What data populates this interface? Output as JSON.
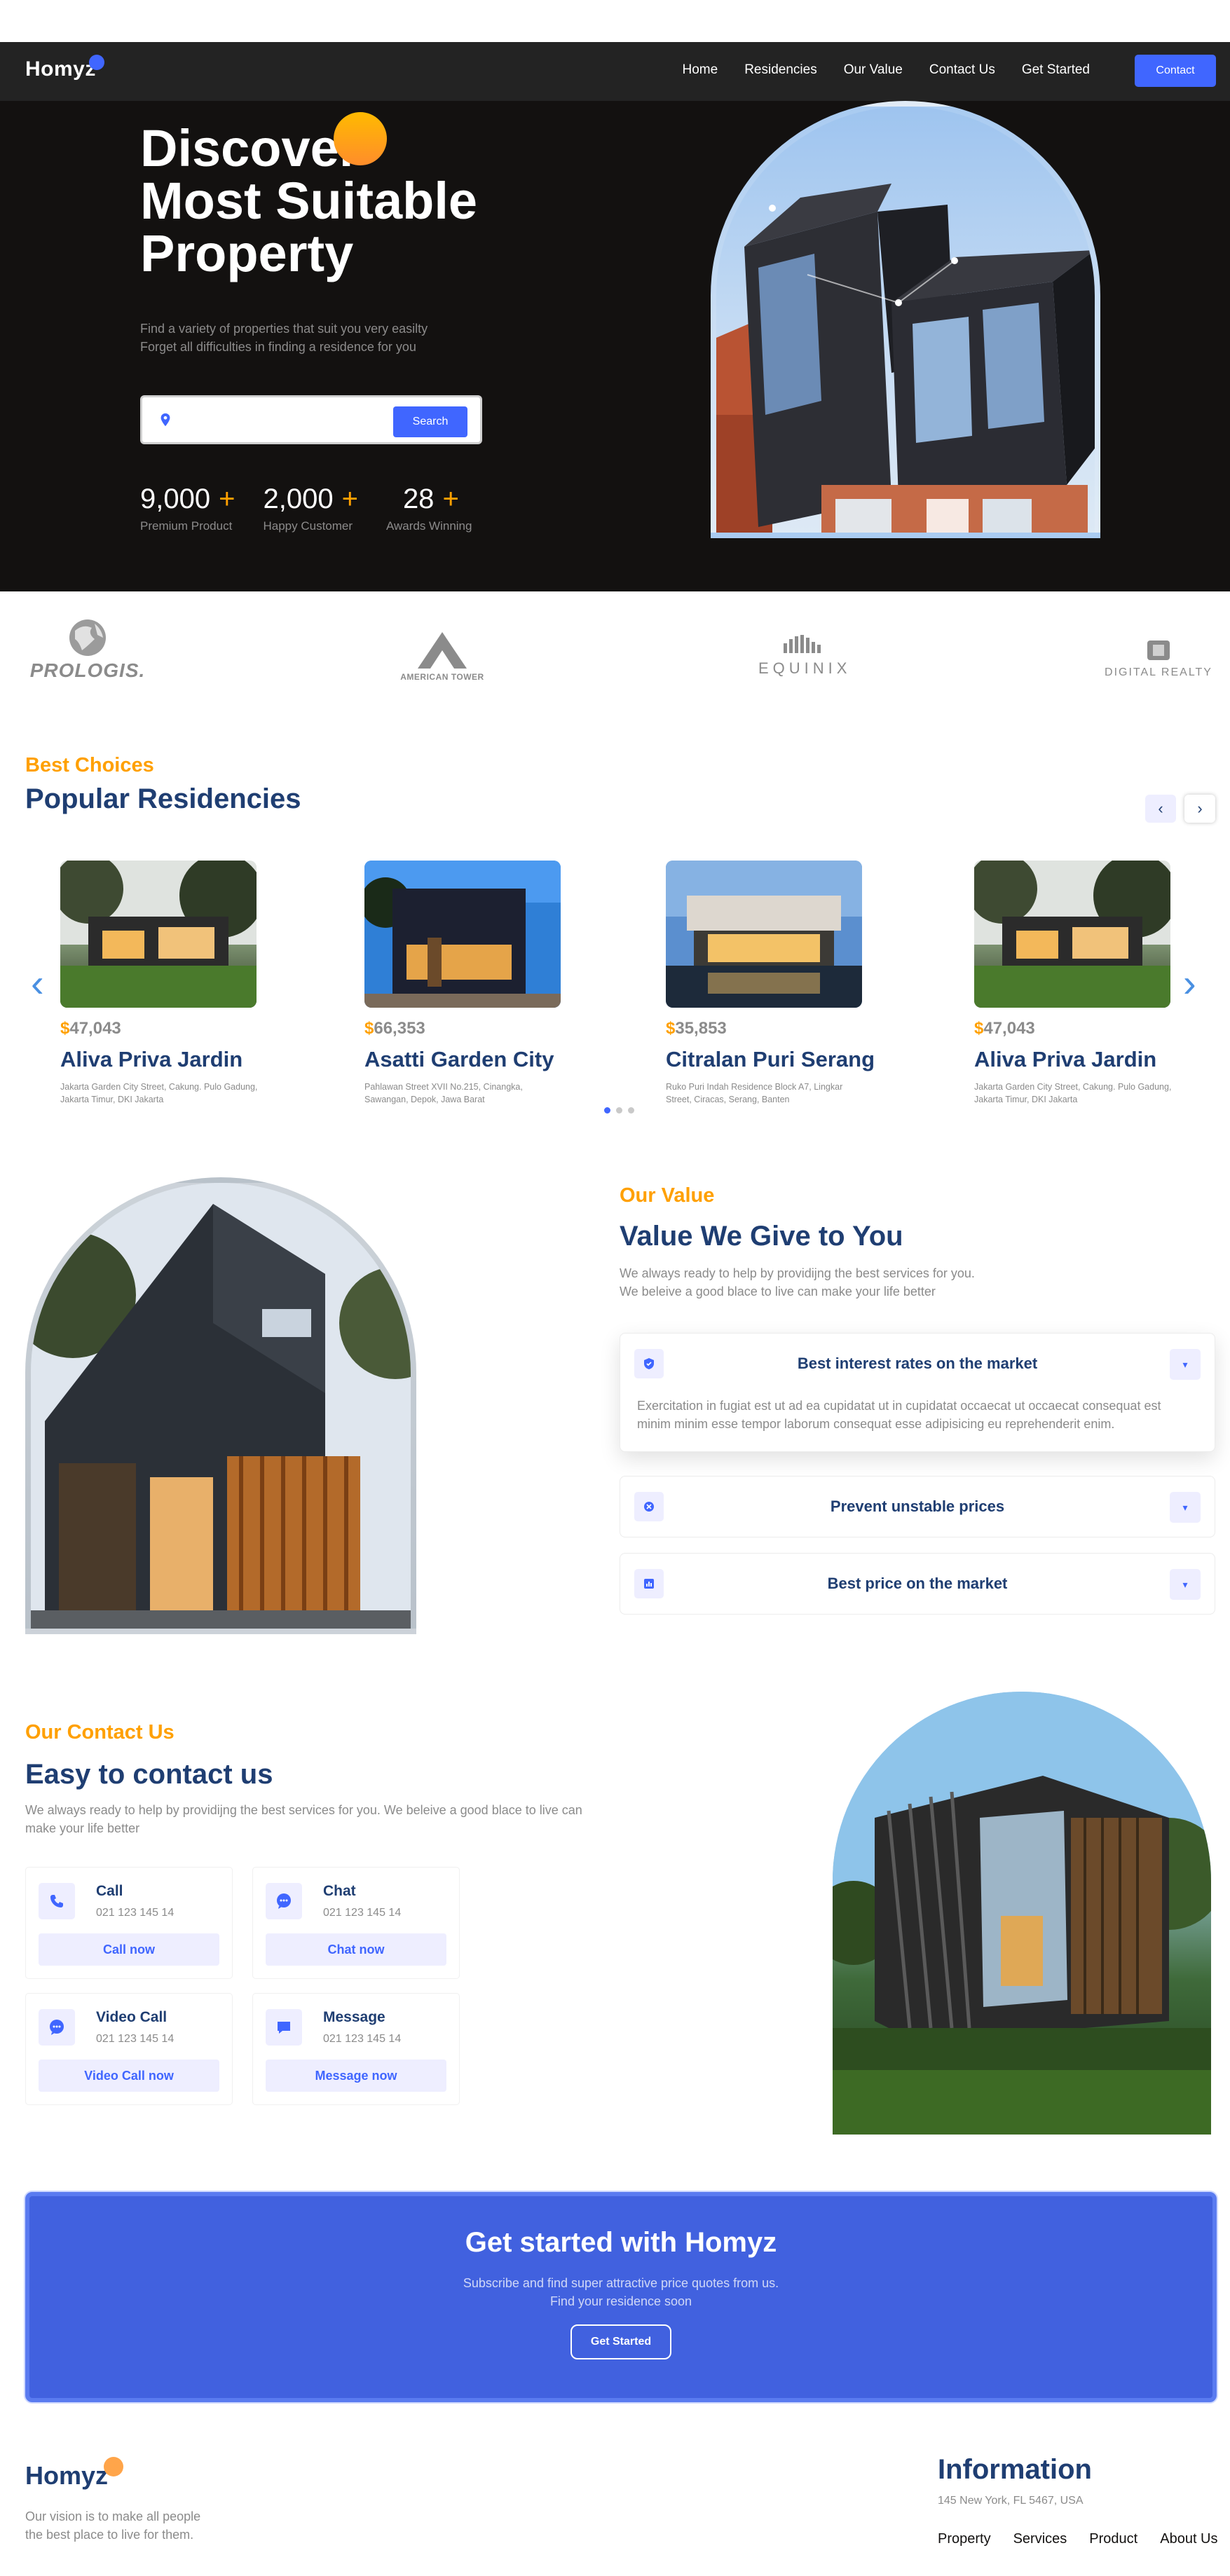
{
  "nav": {
    "logo": "Homyz",
    "links": [
      "Home",
      "Residencies",
      "Our Value",
      "Contact Us",
      "Get Started"
    ],
    "contact_button": "Contact"
  },
  "hero": {
    "title_lines": [
      "Discover",
      "Most Suitable",
      "Property"
    ],
    "subtitle_lines": [
      "Find a variety of properties that suit you very easilty",
      "Forget all difficulties in finding a residence for you"
    ],
    "search_placeholder": "",
    "search_button": "Search",
    "stats": [
      {
        "value": "9,000",
        "plus": "+",
        "label": "Premium Product"
      },
      {
        "value": "2,000",
        "plus": "+",
        "label": "Happy Customer"
      },
      {
        "value": "28",
        "plus": "+",
        "label": "Awards Winning"
      }
    ]
  },
  "brands": [
    "PROLOGIS.",
    "AMERICAN TOWER",
    "EQUINIX",
    "DIGITAL REALTY"
  ],
  "residencies": {
    "kicker": "Best Choices",
    "title": "Popular Residencies",
    "cards": [
      {
        "currency": "$",
        "price": "47,043",
        "name": "Aliva Priva Jardin",
        "desc": "Jakarta Garden City Street, Cakung. Pulo Gadung, Jakarta Timur, DKI Jakarta"
      },
      {
        "currency": "$",
        "price": "66,353",
        "name": "Asatti Garden City",
        "desc": "Pahlawan Street XVII No.215, Cinangka, Sawangan, Depok, Jawa Barat"
      },
      {
        "currency": "$",
        "price": "35,853",
        "name": "Citralan Puri Serang",
        "desc": "Ruko Puri Indah Residence Block A7, Lingkar Street, Ciracas, Serang, Banten"
      },
      {
        "currency": "$",
        "price": "47,043",
        "name": "Aliva Priva Jardin",
        "desc": "Jakarta Garden City Street, Cakung. Pulo Gadung, Jakarta Timur, DKI Jakarta"
      }
    ]
  },
  "value": {
    "kicker": "Our Value",
    "title": "Value We Give to You",
    "subtitle_lines": [
      "We always ready to help by providijng the best services for you.",
      "We beleive a good blace to live can make your life better"
    ],
    "items": [
      {
        "title": "Best interest rates on the market",
        "body": "Exercitation in fugiat est ut ad ea cupidatat ut in cupidatat occaecat ut occaecat consequat est minim minim esse tempor laborum consequat esse adipisicing eu reprehenderit enim.",
        "expanded": true
      },
      {
        "title": "Prevent unstable prices",
        "expanded": false
      },
      {
        "title": "Best price on the market",
        "expanded": false
      }
    ]
  },
  "contact": {
    "kicker": "Our Contact Us",
    "title": "Easy to contact us",
    "subtitle_lines": [
      "We always ready to help by providijng the best services for you. We beleive a good blace to live can",
      "make your life better"
    ],
    "modes": [
      {
        "title": "Call",
        "number": "021 123 145 14",
        "button": "Call now"
      },
      {
        "title": "Chat",
        "number": "021 123 145 14",
        "button": "Chat now"
      },
      {
        "title": "Video Call",
        "number": "021 123 145 14",
        "button": "Video Call now"
      },
      {
        "title": "Message",
        "number": "021 123 145 14",
        "button": "Message now"
      }
    ]
  },
  "cta": {
    "title": "Get started with Homyz",
    "subtitle_lines": [
      "Subscribe and find super attractive price quotes from us.",
      "Find your residence soon"
    ],
    "button": "Get Started"
  },
  "footer": {
    "logo": "Homyz",
    "vision_lines": [
      "Our vision is to make all people",
      "the best place to live for them."
    ],
    "info_title": "Information",
    "address": "145 New York, FL 5467, USA",
    "links": [
      "Property",
      "Services",
      "Product",
      "About Us"
    ]
  },
  "colors": {
    "primary": "#1f3e72",
    "accent_blue": "#4066ff",
    "accent_orange": "#ffa000",
    "hero_bg": "#131110",
    "nav_bg": "#232323"
  }
}
